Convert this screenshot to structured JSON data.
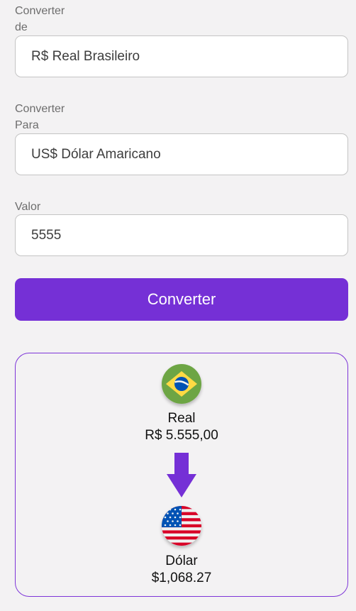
{
  "from": {
    "label": "Converter de",
    "value": "R$ Real Brasileiro"
  },
  "to": {
    "label": "Converter Para",
    "value": "US$ Dólar Amaricano"
  },
  "amount": {
    "label": "Valor",
    "value": "5555"
  },
  "convert_button_label": "Converter",
  "result": {
    "source_name": "Real",
    "source_value": "R$ 5.555,00",
    "source_flag_icon": "brazil-flag-icon",
    "target_name": "Dólar",
    "target_value": "$1,068.27",
    "target_flag_icon": "usa-flag-icon"
  },
  "colors": {
    "accent": "#7530d6",
    "background": "#f3f2f3",
    "card_border": "#7d35d8"
  }
}
